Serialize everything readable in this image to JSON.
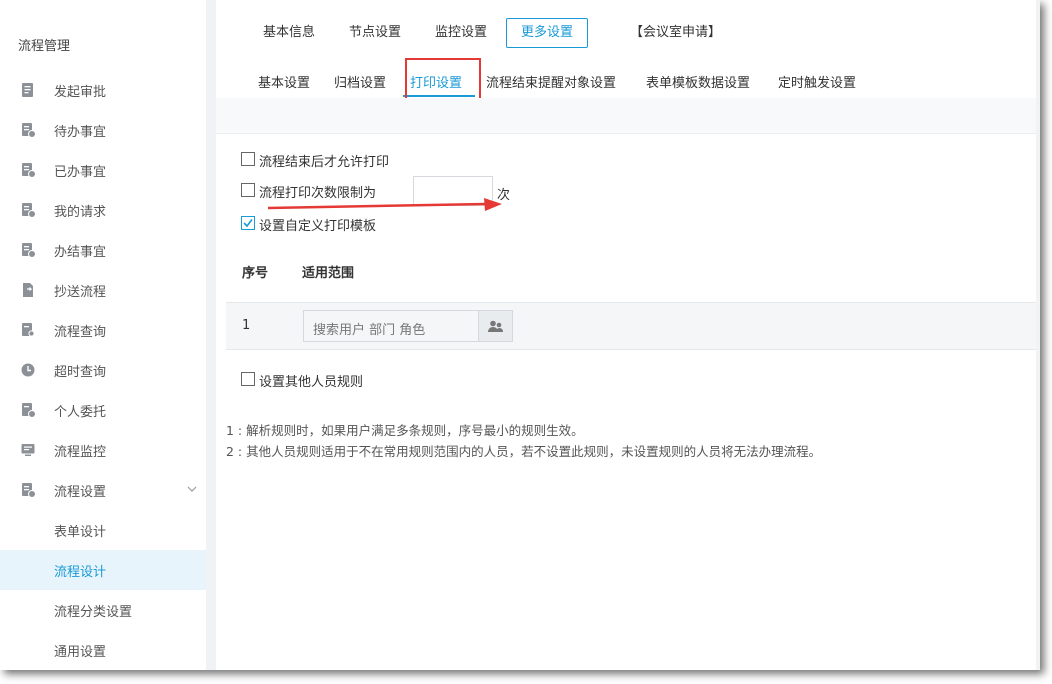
{
  "sidebar": {
    "title": "流程管理",
    "items": [
      {
        "label": "发起审批",
        "icon": "doc-edit-icon"
      },
      {
        "label": "待办事宜",
        "icon": "doc-clock-icon"
      },
      {
        "label": "已办事宜",
        "icon": "doc-check-icon"
      },
      {
        "label": "我的请求",
        "icon": "doc-user-icon"
      },
      {
        "label": "办结事宜",
        "icon": "doc-done-icon"
      },
      {
        "label": "抄送流程",
        "icon": "doc-forward-icon"
      },
      {
        "label": "流程查询",
        "icon": "doc-search-icon"
      },
      {
        "label": "超时查询",
        "icon": "clock-icon"
      },
      {
        "label": "个人委托",
        "icon": "doc-delegate-icon"
      },
      {
        "label": "流程监控",
        "icon": "monitor-icon"
      },
      {
        "label": "流程设置",
        "icon": "doc-settings-icon"
      }
    ],
    "sub_items": [
      {
        "label": "表单设计"
      },
      {
        "label": "流程设计"
      },
      {
        "label": "流程分类设置"
      },
      {
        "label": "通用设置"
      }
    ]
  },
  "top_tabs": [
    "基本信息",
    "节点设置",
    "监控设置",
    "更多设置",
    "【会议室申请】"
  ],
  "sub_tabs": [
    "基本设置",
    "归档设置",
    "打印设置",
    "流程结束提醒对象设置",
    "表单模板数据设置",
    "定时触发设置"
  ],
  "print": {
    "opt_after_end": "流程结束后才允许打印",
    "opt_limit": "流程打印次数限制为",
    "limit_value": "",
    "limit_unit": "次",
    "opt_template": "设置自定义打印模板",
    "table": {
      "headers": [
        "序号",
        "适用范围"
      ],
      "rows": [
        {
          "no": "1",
          "scope_placeholder": "搜索用户 部门 角色"
        }
      ]
    },
    "opt_other_rules": "设置其他人员规则",
    "notes": [
      "1 : 解析规则时，如果用户满足多条规则，序号最小的规则生效。",
      "2 : 其他人员规则适用于不在常用规则范围内的人员，若不设置此规则，未设置规则的人员将无法办理流程。"
    ]
  },
  "colors": {
    "accent": "#1a9ad6",
    "highlight": "#e53935",
    "active_bg": "#e7f4fb"
  }
}
